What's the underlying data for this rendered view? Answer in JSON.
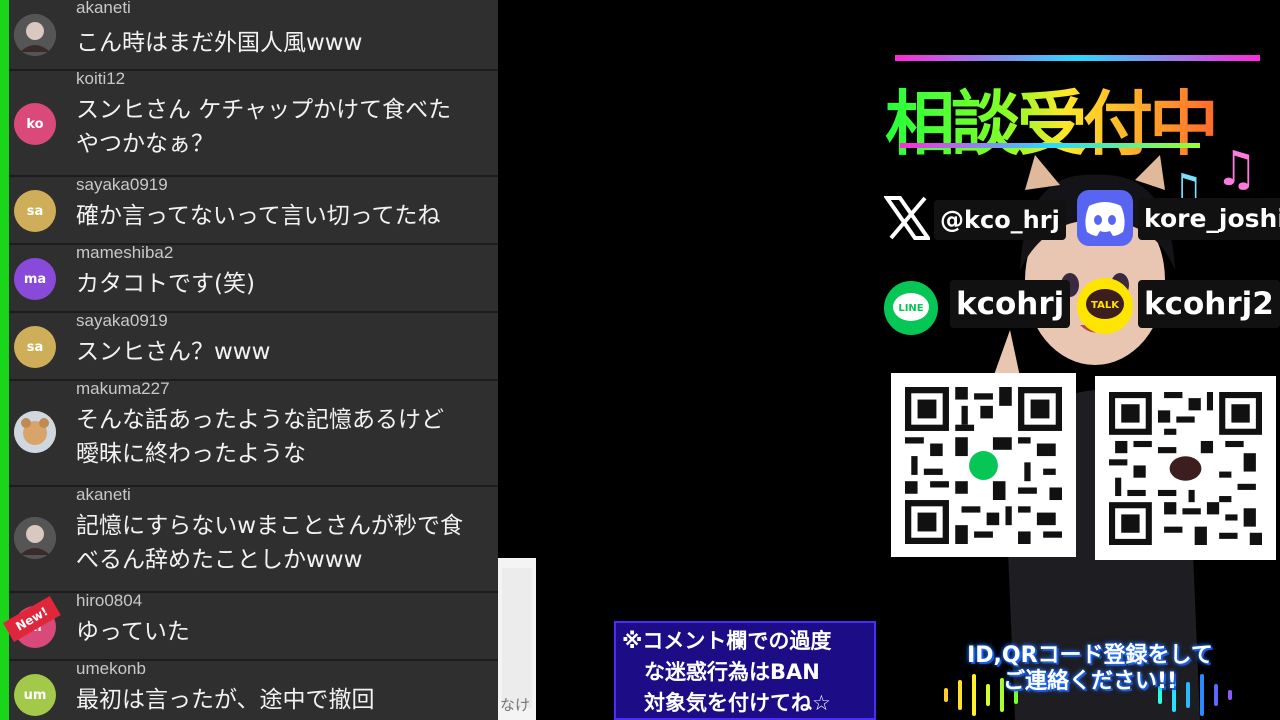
{
  "chat": {
    "messages": [
      {
        "user": "akaneti",
        "text": "こん時はまだ外国人風www",
        "avatar": "",
        "avatar_color": "#6a6a6a",
        "is_new": false
      },
      {
        "user": "koiti12",
        "text": "スンヒさん ケチャップかけて食べた\nやつかなぁ？",
        "avatar": "ko",
        "avatar_color": "#d94a7a",
        "is_new": false
      },
      {
        "user": "sayaka0919",
        "text": "確か言ってないって言い切ってたね",
        "avatar": "sa",
        "avatar_color": "#cfae5a",
        "is_new": false
      },
      {
        "user": "mameshiba2",
        "text": "カタコトです(笑)",
        "avatar": "ma",
        "avatar_color": "#8a4ad9",
        "is_new": false
      },
      {
        "user": "sayaka0919",
        "text": "スンヒさん？www",
        "avatar": "sa",
        "avatar_color": "#cfae5a",
        "is_new": false
      },
      {
        "user": "makuma227",
        "text": "そんな話あったような記憶あるけど\n曖昧に終わったような",
        "avatar": "",
        "avatar_color": "#d7a56a",
        "is_new": false
      },
      {
        "user": "akaneti",
        "text": "記憶にすらないwまことさんが秒で食\nべるん辞めたことしかwww",
        "avatar": "",
        "avatar_color": "#6a6a6a",
        "is_new": false
      },
      {
        "user": "hiro0804",
        "text": "ゆっていた",
        "avatar": "hi",
        "avatar_color": "#d94a7a",
        "is_new": true
      },
      {
        "user": "umekonb",
        "text": "最初は言ったが、途中で撤回",
        "avatar": "um",
        "avatar_color": "#a3c94a",
        "is_new": false
      }
    ],
    "new_badge": "New!",
    "card_peek": "なけ"
  },
  "overlay": {
    "title": "相談受付中",
    "x_handle": "@kco_hrj",
    "discord_handle": "kore_joshi",
    "line_handle": "kcohrj",
    "kakao_handle": "kcohrj2",
    "line_icon_text": "LINE",
    "kakao_icon_text": "TALK",
    "notice_lines": [
      "※コメント欄での過度",
      "な迷惑行為はBAN",
      "対象気を付けてね☆"
    ],
    "contact_lines": [
      "ID,QRコード登録をして",
      "ご連絡ください!!"
    ]
  },
  "colors": {
    "accent_green": "#1ad61a",
    "notice_bg": "#1c0d87",
    "discord": "#5865f2",
    "line": "#06c755",
    "kakao": "#fee500"
  }
}
